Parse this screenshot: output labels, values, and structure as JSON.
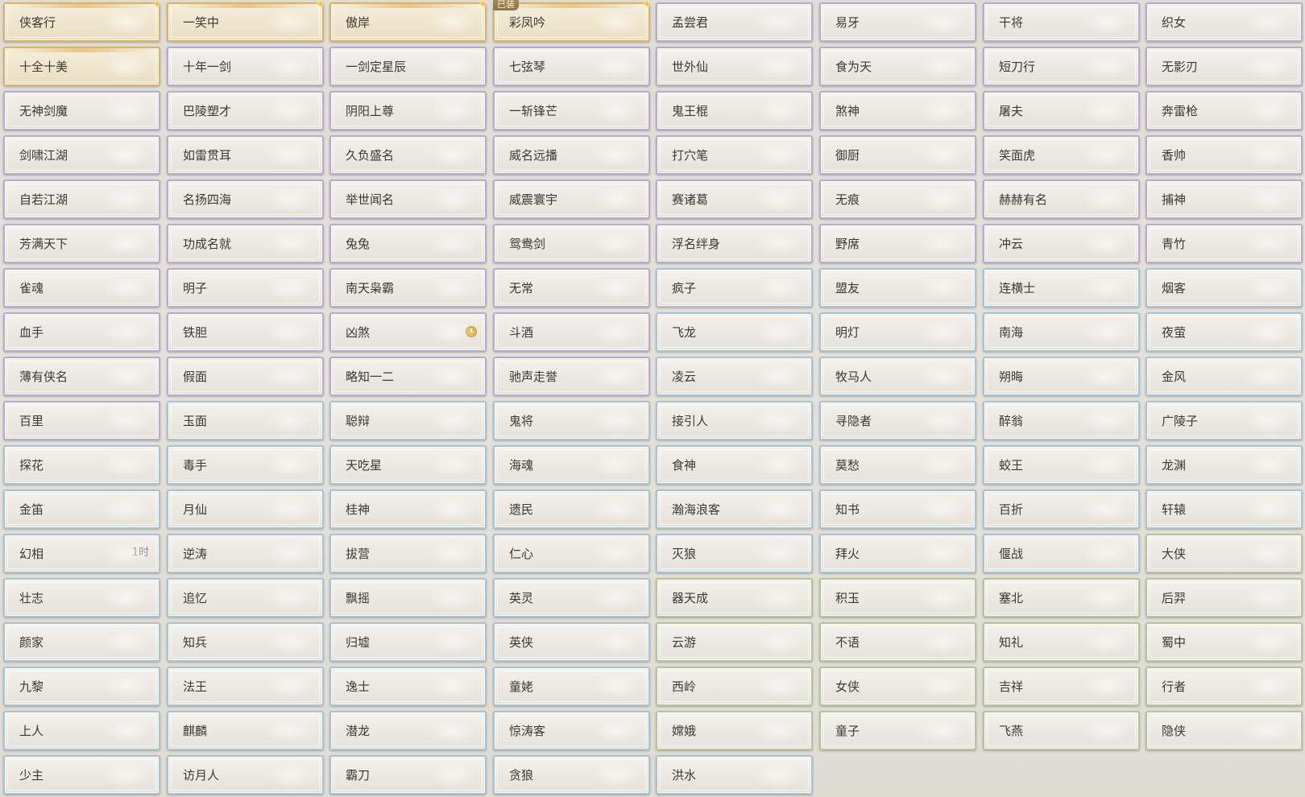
{
  "equipped_badge": "已装",
  "titles": [
    {
      "name": "侠客行",
      "rarity": "gold",
      "sparkle": true
    },
    {
      "name": "一笑中",
      "rarity": "gold",
      "sparkle": true
    },
    {
      "name": "傲岸",
      "rarity": "gold",
      "sparkle": true
    },
    {
      "name": "彩凤吟",
      "rarity": "gold",
      "sparkle": true,
      "equipped": true
    },
    {
      "name": "孟尝君",
      "rarity": "purple"
    },
    {
      "name": "易牙",
      "rarity": "purple"
    },
    {
      "name": "干将",
      "rarity": "purple"
    },
    {
      "name": "织女",
      "rarity": "purple"
    },
    {
      "name": "十全十美",
      "rarity": "gold"
    },
    {
      "name": "十年一剑",
      "rarity": "purple"
    },
    {
      "name": "一剑定星辰",
      "rarity": "purple"
    },
    {
      "name": "七弦琴",
      "rarity": "purple"
    },
    {
      "name": "世外仙",
      "rarity": "purple"
    },
    {
      "name": "食为天",
      "rarity": "purple"
    },
    {
      "name": "短刀行",
      "rarity": "purple"
    },
    {
      "name": "无影刃",
      "rarity": "purple"
    },
    {
      "name": "无神剑魔",
      "rarity": "purple"
    },
    {
      "name": "巴陵塑才",
      "rarity": "purple"
    },
    {
      "name": "阴阳上尊",
      "rarity": "purple"
    },
    {
      "name": "一斩锋芒",
      "rarity": "purple"
    },
    {
      "name": "鬼王棍",
      "rarity": "purple"
    },
    {
      "name": "煞神",
      "rarity": "purple"
    },
    {
      "name": "屠夫",
      "rarity": "purple"
    },
    {
      "name": "奔雷枪",
      "rarity": "purple"
    },
    {
      "name": "剑啸江湖",
      "rarity": "purple"
    },
    {
      "name": "如雷贯耳",
      "rarity": "purple"
    },
    {
      "name": "久负盛名",
      "rarity": "purple"
    },
    {
      "name": "威名远播",
      "rarity": "purple"
    },
    {
      "name": "打穴笔",
      "rarity": "purple"
    },
    {
      "name": "御厨",
      "rarity": "purple"
    },
    {
      "name": "笑面虎",
      "rarity": "purple"
    },
    {
      "name": "香帅",
      "rarity": "purple"
    },
    {
      "name": "自若江湖",
      "rarity": "purple"
    },
    {
      "name": "名扬四海",
      "rarity": "purple"
    },
    {
      "name": "举世闻名",
      "rarity": "purple"
    },
    {
      "name": "威震寰宇",
      "rarity": "purple"
    },
    {
      "name": "赛诸葛",
      "rarity": "purple"
    },
    {
      "name": "无痕",
      "rarity": "purple"
    },
    {
      "name": "赫赫有名",
      "rarity": "purple"
    },
    {
      "name": "捕神",
      "rarity": "purple"
    },
    {
      "name": "芳满天下",
      "rarity": "purple"
    },
    {
      "name": "功成名就",
      "rarity": "purple"
    },
    {
      "name": "兔兔",
      "rarity": "purple"
    },
    {
      "name": "鸳鸯剑",
      "rarity": "purple"
    },
    {
      "name": "浮名绊身",
      "rarity": "purple"
    },
    {
      "name": "野席",
      "rarity": "purple"
    },
    {
      "name": "冲云",
      "rarity": "purple"
    },
    {
      "name": "青竹",
      "rarity": "purple"
    },
    {
      "name": "雀魂",
      "rarity": "purple"
    },
    {
      "name": "明子",
      "rarity": "purple"
    },
    {
      "name": "南天枭霸",
      "rarity": "purple"
    },
    {
      "name": "无常",
      "rarity": "purple"
    },
    {
      "name": "疯子",
      "rarity": "blue"
    },
    {
      "name": "盟友",
      "rarity": "blue"
    },
    {
      "name": "连横士",
      "rarity": "blue"
    },
    {
      "name": "烟客",
      "rarity": "blue"
    },
    {
      "name": "血手",
      "rarity": "purple"
    },
    {
      "name": "铁胆",
      "rarity": "purple"
    },
    {
      "name": "凶煞",
      "rarity": "purple",
      "clock": true
    },
    {
      "name": "斗酒",
      "rarity": "purple"
    },
    {
      "name": "飞龙",
      "rarity": "blue"
    },
    {
      "name": "明灯",
      "rarity": "blue"
    },
    {
      "name": "南海",
      "rarity": "blue"
    },
    {
      "name": "夜萤",
      "rarity": "blue"
    },
    {
      "name": "薄有侠名",
      "rarity": "purple"
    },
    {
      "name": "假面",
      "rarity": "purple"
    },
    {
      "name": "略知一二",
      "rarity": "purple"
    },
    {
      "name": "驰声走誉",
      "rarity": "purple"
    },
    {
      "name": "凌云",
      "rarity": "blue"
    },
    {
      "name": "牧马人",
      "rarity": "blue"
    },
    {
      "name": "朔晦",
      "rarity": "blue"
    },
    {
      "name": "金风",
      "rarity": "blue"
    },
    {
      "name": "百里",
      "rarity": "purple"
    },
    {
      "name": "玉面",
      "rarity": "blue"
    },
    {
      "name": "聪辩",
      "rarity": "blue"
    },
    {
      "name": "鬼将",
      "rarity": "blue"
    },
    {
      "name": "接引人",
      "rarity": "blue"
    },
    {
      "name": "寻隐者",
      "rarity": "blue"
    },
    {
      "name": "醉翁",
      "rarity": "blue"
    },
    {
      "name": "广陵子",
      "rarity": "blue"
    },
    {
      "name": "探花",
      "rarity": "blue"
    },
    {
      "name": "毒手",
      "rarity": "blue"
    },
    {
      "name": "天吃星",
      "rarity": "blue"
    },
    {
      "name": "海魂",
      "rarity": "blue"
    },
    {
      "name": "食神",
      "rarity": "blue"
    },
    {
      "name": "莫愁",
      "rarity": "blue"
    },
    {
      "name": "蛟王",
      "rarity": "blue"
    },
    {
      "name": "龙渊",
      "rarity": "blue"
    },
    {
      "name": "金笛",
      "rarity": "blue"
    },
    {
      "name": "月仙",
      "rarity": "blue"
    },
    {
      "name": "桂神",
      "rarity": "blue"
    },
    {
      "name": "遗民",
      "rarity": "blue"
    },
    {
      "name": "瀚海浪客",
      "rarity": "blue"
    },
    {
      "name": "知书",
      "rarity": "blue"
    },
    {
      "name": "百折",
      "rarity": "blue"
    },
    {
      "name": "轩辕",
      "rarity": "blue"
    },
    {
      "name": "幻相",
      "rarity": "blue",
      "timer": "1时"
    },
    {
      "name": "逆涛",
      "rarity": "blue"
    },
    {
      "name": "拔营",
      "rarity": "blue"
    },
    {
      "name": "仁心",
      "rarity": "blue"
    },
    {
      "name": "灭狼",
      "rarity": "blue"
    },
    {
      "name": "拜火",
      "rarity": "blue"
    },
    {
      "name": "偃战",
      "rarity": "blue"
    },
    {
      "name": "大侠",
      "rarity": "green"
    },
    {
      "name": "壮志",
      "rarity": "blue"
    },
    {
      "name": "追忆",
      "rarity": "blue"
    },
    {
      "name": "飘摇",
      "rarity": "blue"
    },
    {
      "name": "英灵",
      "rarity": "blue"
    },
    {
      "name": "器天成",
      "rarity": "green"
    },
    {
      "name": "积玉",
      "rarity": "green"
    },
    {
      "name": "塞北",
      "rarity": "green"
    },
    {
      "name": "后羿",
      "rarity": "green"
    },
    {
      "name": "颜家",
      "rarity": "blue"
    },
    {
      "name": "知兵",
      "rarity": "blue"
    },
    {
      "name": "归墟",
      "rarity": "blue"
    },
    {
      "name": "英侠",
      "rarity": "blue"
    },
    {
      "name": "云游",
      "rarity": "green"
    },
    {
      "name": "不语",
      "rarity": "green"
    },
    {
      "name": "知礼",
      "rarity": "green"
    },
    {
      "name": "蜀中",
      "rarity": "green"
    },
    {
      "name": "九黎",
      "rarity": "blue"
    },
    {
      "name": "法王",
      "rarity": "blue"
    },
    {
      "name": "逸士",
      "rarity": "blue"
    },
    {
      "name": "童姥",
      "rarity": "blue"
    },
    {
      "name": "西岭",
      "rarity": "green"
    },
    {
      "name": "女侠",
      "rarity": "green"
    },
    {
      "name": "吉祥",
      "rarity": "green"
    },
    {
      "name": "行者",
      "rarity": "green"
    },
    {
      "name": "上人",
      "rarity": "blue"
    },
    {
      "name": "麒麟",
      "rarity": "blue"
    },
    {
      "name": "潜龙",
      "rarity": "blue"
    },
    {
      "name": "惊涛客",
      "rarity": "blue"
    },
    {
      "name": "嫦娥",
      "rarity": "green"
    },
    {
      "name": "童子",
      "rarity": "green"
    },
    {
      "name": "飞燕",
      "rarity": "green"
    },
    {
      "name": "隐侠",
      "rarity": "green"
    },
    {
      "name": "少主",
      "rarity": "blue"
    },
    {
      "name": "访月人",
      "rarity": "blue"
    },
    {
      "name": "霸刀",
      "rarity": "blue"
    },
    {
      "name": "贪狼",
      "rarity": "blue"
    },
    {
      "name": "洪水",
      "rarity": "blue"
    }
  ]
}
